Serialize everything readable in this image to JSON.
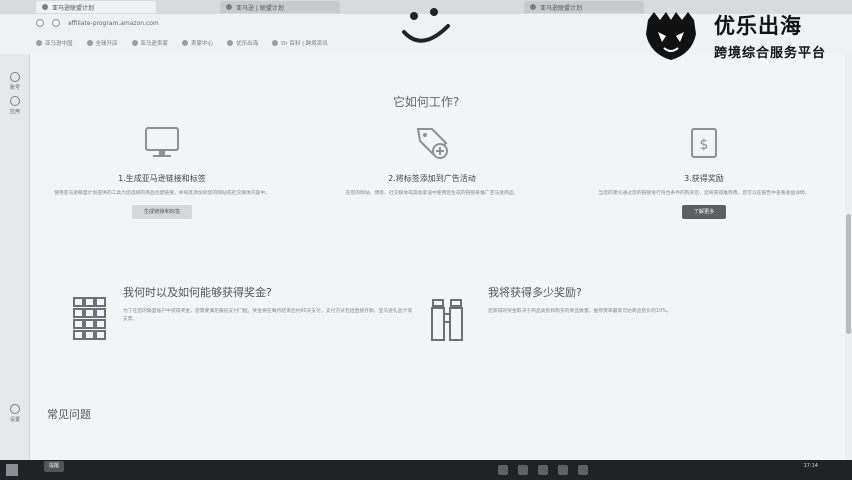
{
  "browser": {
    "tabs": [
      "亚马逊联盟计划",
      "亚马逊 | 联盟计划",
      "亚马逊联盟计划"
    ],
    "url": "affiliate-program.amazon.com",
    "bookmarks": [
      "亚马逊中国",
      "全球开店",
      "亚马逊卖家",
      "卖家中心",
      "优乐出海",
      "Dr 百科 | 跨境资讯"
    ]
  },
  "rail": [
    "账号",
    "应用",
    "设置"
  ],
  "watermark": {
    "title": "优乐出海",
    "subtitle": "跨境综合服务平台"
  },
  "main": {
    "how_heading": "它如何工作?",
    "steps": [
      {
        "title": "1.生成亚马逊链接和标签",
        "desc": "使用亚马逊联盟计划提供的工具为您选择的商品创建链接，并将其添加到您的网站或社交媒体内容中。",
        "button": "生成链接和标签"
      },
      {
        "title": "2.将标签添加到广告活动",
        "desc": "在您的网站、博客、社交媒体或其他渠道中使用您生成的链接来推广亚马逊商品。",
        "button": ""
      },
      {
        "title": "3.获得奖励",
        "desc": "当您的受众通过您的链接进行符合条件的购买后，您将获得推荐费。您可以在报告中查看收益详情。",
        "button": "了解更多"
      }
    ],
    "q1": {
      "title": "我何时以及如何能够获得奖金?",
      "desc": "为了在您的联盟账户中获得奖金，您需要满足最低支付门槛。奖金将在每月结束后约60天支付，支付方式包括直接存款、亚马逊礼品卡或支票。"
    },
    "q2": {
      "title": "我将获得多少奖励?",
      "desc": "您获得的奖金取决于商品类别和购买的商品数量，推荐费率最高可达商品售价的10%。"
    },
    "faq": "常见问题"
  },
  "taskbar": {
    "clock": "17:14",
    "notice": "提醒"
  }
}
